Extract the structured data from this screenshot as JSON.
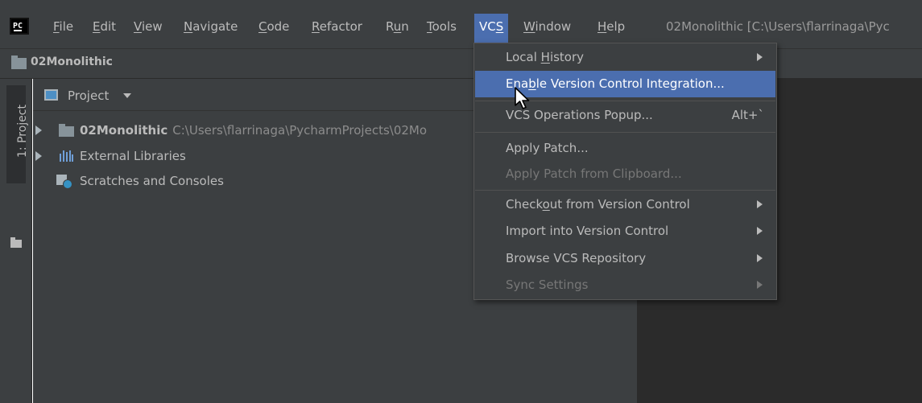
{
  "app": {
    "logo_text": "PC",
    "window_title": "02Monolithic [C:\\Users\\flarrinaga\\Pyc"
  },
  "menubar": {
    "items": [
      {
        "pre": "",
        "u": "F",
        "post": "ile"
      },
      {
        "pre": "",
        "u": "E",
        "post": "dit"
      },
      {
        "pre": "",
        "u": "V",
        "post": "iew"
      },
      {
        "pre": "",
        "u": "N",
        "post": "avigate"
      },
      {
        "pre": "",
        "u": "C",
        "post": "ode"
      },
      {
        "pre": "",
        "u": "R",
        "post": "efactor"
      },
      {
        "pre": "R",
        "u": "u",
        "post": "n"
      },
      {
        "pre": "",
        "u": "T",
        "post": "ools"
      },
      {
        "pre": "VC",
        "u": "S",
        "post": ""
      },
      {
        "pre": "",
        "u": "W",
        "post": "indow"
      },
      {
        "pre": "",
        "u": "H",
        "post": "elp"
      }
    ]
  },
  "navbar": {
    "title": "02Monolithic"
  },
  "stripe": {
    "tab_label": "1: Project"
  },
  "project_panel": {
    "title": "Project",
    "tree": [
      {
        "label": "02Monolithic",
        "path": "C:\\Users\\flarrinaga\\PycharmProjects\\02Mo"
      },
      {
        "label": "External Libraries"
      },
      {
        "label": "Scratches and Consoles"
      }
    ]
  },
  "vcs_menu": {
    "items": [
      {
        "pre": "Local ",
        "u": "H",
        "post": "istory",
        "submenu": true
      },
      {
        "pre": "Ena",
        "u": "b",
        "post": "le Version Control Integration...",
        "highlight": true
      },
      {
        "pre": "VCS Operations Popup...",
        "u": "",
        "post": "",
        "shortcut": "Alt+`"
      },
      {
        "pre": "Apply Patch...",
        "u": "",
        "post": ""
      },
      {
        "pre": "Apply Patch from Clipboard...",
        "u": "",
        "post": "",
        "disabled": true
      },
      {
        "pre": "Check",
        "u": "o",
        "post": "ut from Version Control",
        "submenu": true
      },
      {
        "pre": "Import into Version Control",
        "u": "",
        "post": "",
        "submenu": true
      },
      {
        "pre": "Browse VCS Repository",
        "u": "",
        "post": "",
        "submenu": true
      },
      {
        "pre": "Sync Settings",
        "u": "",
        "post": "",
        "submenu": true,
        "disabled": true
      }
    ]
  },
  "colors": {
    "accent": "#4b6eaf",
    "background": "#3c3f41",
    "editor": "#2b2b2b"
  }
}
